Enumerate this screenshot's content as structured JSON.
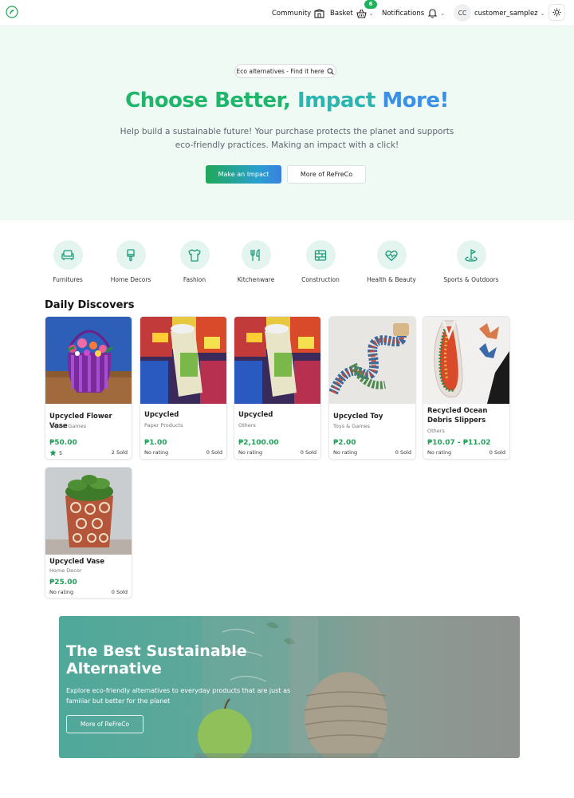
{
  "nav": {
    "community": "Community",
    "basket": "Basket",
    "basket_count": "6",
    "notifications": "Notifications",
    "avatar_initials": "CC",
    "username": "customer_samplez"
  },
  "hero": {
    "search_chip": "Eco alternatives - Find it here",
    "title_part1": "Choose Better,",
    "title_part2": "Impact",
    "title_part3": "More!",
    "subtitle": "Help build a sustainable future! Your purchase protects the planet and supports eco-friendly practices. Making an impact with a click!",
    "btn_impact": "Make an Impact",
    "btn_more": "More of ReFreCo"
  },
  "categories": [
    {
      "label": "Furnitures",
      "icon": "sofa-icon"
    },
    {
      "label": "Home Decors",
      "icon": "paint-brush-icon"
    },
    {
      "label": "Fashion",
      "icon": "shirt-icon"
    },
    {
      "label": "Kitchenware",
      "icon": "utensils-icon"
    },
    {
      "label": "Construction",
      "icon": "brick-wall-icon"
    },
    {
      "label": "Health & Beauty",
      "icon": "heart-pulse-icon"
    },
    {
      "label": "Sports & Outdoors",
      "icon": "golf-icon"
    }
  ],
  "daily": {
    "title": "Daily Discovers",
    "products": [
      {
        "name": "Upcycled Flower Vase",
        "category": "Toys & Games",
        "price": "₱50.00",
        "rating": "5",
        "sold": "2 Sold"
      },
      {
        "name": "Upcycled",
        "category": "Paper Products",
        "price": "₱1.00",
        "rating": "No rating",
        "sold": "0 Sold"
      },
      {
        "name": "Upcycled",
        "category": "Others",
        "price": "₱2,100.00",
        "rating": "No rating",
        "sold": "0 Sold"
      },
      {
        "name": "Upcycled Toy",
        "category": "Toys & Games",
        "price": "₱2.00",
        "rating": "No rating",
        "sold": "0 Sold"
      },
      {
        "name": "Recycled Ocean Debris Slippers",
        "category": "Others",
        "price": "₱10.07 - ₱11.02",
        "rating": "No rating",
        "sold": "0 Sold"
      },
      {
        "name": "Upcycled Vase",
        "category": "Home Decor",
        "price": "₱25.00",
        "rating": "No rating",
        "sold": "0 Sold"
      }
    ]
  },
  "banner": {
    "title": "The Best Sustainable Alternative",
    "subtitle": "Explore eco-friendly alternatives to everyday products that are just as familiar but better for the planet",
    "button": "More of ReFreCo"
  }
}
